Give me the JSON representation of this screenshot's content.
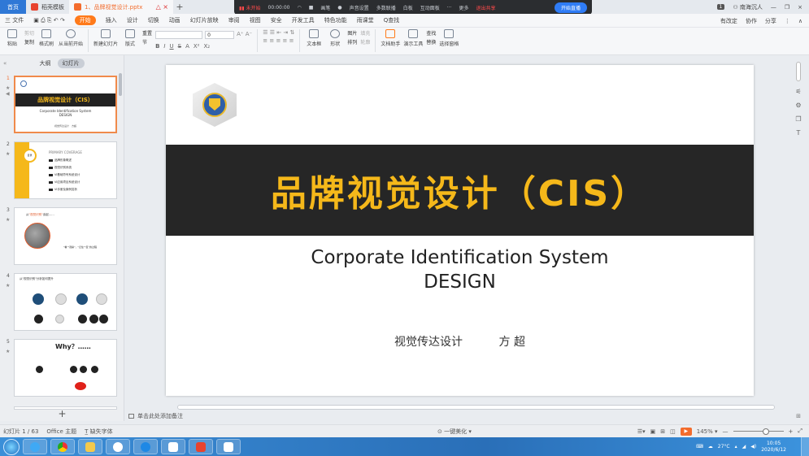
{
  "tabs": {
    "home": "首页",
    "items": [
      {
        "label": "稻壳模板",
        "color": "#e8432e"
      },
      {
        "label": "1、品牌视觉设计.pptx",
        "color": "#f36c2d"
      }
    ]
  },
  "recorder": {
    "status": "未开始",
    "time": "00:00:00",
    "items": [
      "画笔",
      "声音设置",
      "多数联播",
      "白板",
      "互动面板",
      "更多"
    ],
    "exit": "退出共享",
    "live": "开始直播"
  },
  "window": {
    "badge": "1",
    "user": "南海沉人"
  },
  "menubar": {
    "file": "三 文件",
    "start": "开始",
    "items": [
      "插入",
      "设计",
      "切换",
      "动画",
      "幻灯片放映",
      "审阅",
      "视图",
      "安全",
      "开发工具",
      "特色功能",
      "雨课堂"
    ],
    "search": "Q查找",
    "right": [
      "有改定",
      "协作",
      "分享"
    ]
  },
  "ribbon": {
    "paste": "粘贴",
    "cut": "剪切",
    "copy": "复制",
    "format_painter": "格式刷",
    "from_current": "从当前开始",
    "new_slide": "新建幻灯片",
    "layout": "版式",
    "section": "节",
    "reset": "重置",
    "font_size": "0",
    "textbox": "文本框",
    "shape": "形状",
    "arrange": "排列",
    "picture": "图片",
    "fill": "填充",
    "outline": "轮廓",
    "doc_helper": "文档助手",
    "present_tools": "演示工具",
    "find": "查找",
    "replace": "替换",
    "select_pane": "选择窗格"
  },
  "leftpanel": {
    "tab_outline": "大纲",
    "tab_slides": "幻灯片",
    "thumb1": {
      "title": "品牌视觉设计（CIS）",
      "sub1": "Corporate Identification System",
      "sub2": "DESIGN",
      "foot": "视觉传达设计　方超"
    },
    "thumb2": {
      "badge": "目录",
      "title": "PRIMARY COVERAGE",
      "items": [
        "品牌形象概述",
        "视觉识别系统",
        "VI基础符号系统设计",
        "VI应用项目系统设计",
        "VI手册及案例赏析"
      ]
    },
    "thumb3": {
      "head_pre": "从",
      "head_em": "\"视觉识别\"",
      "head_post": "谈起……",
      "note": "\"看\"\"观察\"，\"记住\"\"区\"的过程"
    },
    "thumb4": {
      "head": "从\"视觉识别\"分析如何提升"
    },
    "thumb5": {
      "title": "Why？……"
    },
    "numbers": [
      "1",
      "2",
      "3",
      "4",
      "5"
    ]
  },
  "slide": {
    "title": "品牌视觉设计（CIS）",
    "subtitle_line1": "Corporate Identification System",
    "subtitle_line2": "DESIGN",
    "footer_course": "视觉传达设计",
    "footer_author": "方 超"
  },
  "notes": {
    "placeholder": "单击此处添加备注"
  },
  "status": {
    "slide_count": "幻灯片 1 / 63",
    "theme": "Office 主题",
    "font_missing": "缺失字体",
    "beautify": "一键美化",
    "zoom": "145%"
  },
  "taskbar": {
    "weather": "27°C",
    "time": "10:05",
    "date": "2020/6/12"
  }
}
